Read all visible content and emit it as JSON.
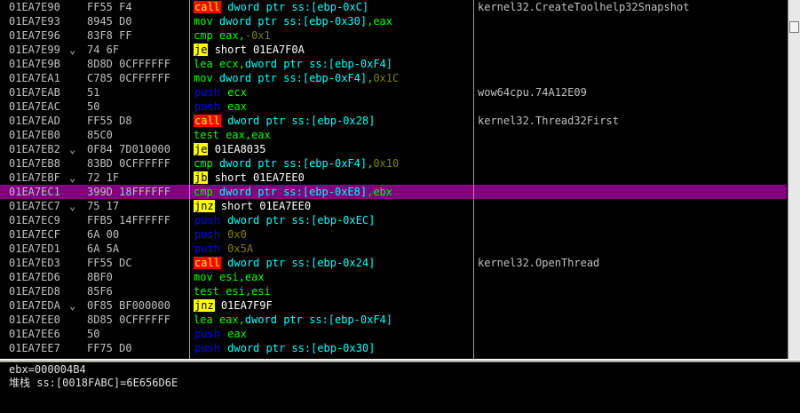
{
  "disasm": {
    "rows": [
      {
        "addr": "01EA7E90",
        "jmp": "",
        "hex": "FF55 F4",
        "mn": "call",
        "mk": "call",
        "ops": [
          {
            "t": "dword ptr ss:[ebp-0xC]",
            "c": "#00ffff"
          }
        ],
        "cmt": "kernel32.CreateToolhelp32Snapshot"
      },
      {
        "addr": "01EA7E93",
        "jmp": "",
        "hex": "8945 D0",
        "mn": "mov",
        "mk": "plain",
        "ops": [
          {
            "t": "dword ptr ss:[ebp-0x30]",
            "c": "#00ffff"
          },
          {
            "t": ",",
            "c": "#00ff00"
          },
          {
            "t": "eax",
            "c": "#00ff00"
          }
        ],
        "cmt": ""
      },
      {
        "addr": "01EA7E96",
        "jmp": "",
        "hex": "83F8 FF",
        "mn": "cmp",
        "mk": "plain",
        "ops": [
          {
            "t": "eax",
            "c": "#00ff00"
          },
          {
            "t": ",",
            "c": "#00ff00"
          },
          {
            "t": "-0x1",
            "c": "#808000"
          }
        ],
        "cmt": ""
      },
      {
        "addr": "01EA7E99",
        "jmp": "⌄",
        "hex": "74 6F",
        "mn": "je",
        "mk": "jmp",
        "ops": [
          {
            "t": "short 01EA7F0A",
            "c": "#ffffff"
          }
        ],
        "cmt": ""
      },
      {
        "addr": "01EA7E9B",
        "jmp": "",
        "hex": "8D8D 0CFFFFFF",
        "mn": "lea",
        "mk": "plain",
        "ops": [
          {
            "t": "ecx",
            "c": "#00ff00"
          },
          {
            "t": ",",
            "c": "#00ff00"
          },
          {
            "t": "dword ptr ss:[ebp-0xF4]",
            "c": "#00ffff"
          }
        ],
        "cmt": ""
      },
      {
        "addr": "01EA7EA1",
        "jmp": "",
        "hex": "C785 0CFFFFFF",
        "mn": "mov",
        "mk": "plain",
        "ops": [
          {
            "t": "dword ptr ss:[ebp-0xF4]",
            "c": "#00ffff"
          },
          {
            "t": ",",
            "c": "#00ff00"
          },
          {
            "t": "0x1C",
            "c": "#808000"
          }
        ],
        "cmt": ""
      },
      {
        "addr": "01EA7EAB",
        "jmp": "",
        "hex": "51",
        "mn": "push",
        "mk": "push",
        "ops": [
          {
            "t": "ecx",
            "c": "#00ff00"
          }
        ],
        "cmt": "wow64cpu.74A12E09"
      },
      {
        "addr": "01EA7EAC",
        "jmp": "",
        "hex": "50",
        "mn": "push",
        "mk": "push",
        "ops": [
          {
            "t": "eax",
            "c": "#00ff00"
          }
        ],
        "cmt": ""
      },
      {
        "addr": "01EA7EAD",
        "jmp": "",
        "hex": "FF55 D8",
        "mn": "call",
        "mk": "call",
        "ops": [
          {
            "t": "dword ptr ss:[ebp-0x28]",
            "c": "#00ffff"
          }
        ],
        "cmt": "kernel32.Thread32First"
      },
      {
        "addr": "01EA7EB0",
        "jmp": "",
        "hex": "85C0",
        "mn": "test",
        "mk": "plain",
        "ops": [
          {
            "t": "eax",
            "c": "#00ff00"
          },
          {
            "t": ",",
            "c": "#00ff00"
          },
          {
            "t": "eax",
            "c": "#00ff00"
          }
        ],
        "cmt": ""
      },
      {
        "addr": "01EA7EB2",
        "jmp": "⌄",
        "hex": "0F84 7D010000",
        "mn": "je",
        "mk": "jmp",
        "ops": [
          {
            "t": "01EA8035",
            "c": "#ffffff"
          }
        ],
        "cmt": ""
      },
      {
        "addr": "01EA7EB8",
        "jmp": "",
        "hex": "83BD 0CFFFFFF",
        "mn": "cmp",
        "mk": "plain",
        "ops": [
          {
            "t": "dword ptr ss:[ebp-0xF4]",
            "c": "#00ffff"
          },
          {
            "t": ",",
            "c": "#00ff00"
          },
          {
            "t": "0x10",
            "c": "#808000"
          }
        ],
        "cmt": ""
      },
      {
        "addr": "01EA7EBF",
        "jmp": "⌄",
        "hex": "72 1F",
        "mn": "jb",
        "mk": "jmp",
        "ops": [
          {
            "t": "short 01EA7EE0",
            "c": "#ffffff"
          }
        ],
        "cmt": ""
      },
      {
        "addr": "01EA7EC1",
        "jmp": "",
        "hex": "399D 18FFFFFF",
        "mn": "cmp",
        "mk": "plain",
        "ops": [
          {
            "t": "dword ptr ss:[ebp-0xE8]",
            "c": "#00ffff"
          },
          {
            "t": ",",
            "c": "#00ff00"
          },
          {
            "t": "ebx",
            "c": "#00ff00"
          }
        ],
        "cmt": "",
        "sel": true
      },
      {
        "addr": "01EA7EC7",
        "jmp": "⌄",
        "hex": "75 17",
        "mn": "jnz",
        "mk": "jmp",
        "ops": [
          {
            "t": "short 01EA7EE0",
            "c": "#ffffff"
          }
        ],
        "cmt": ""
      },
      {
        "addr": "01EA7EC9",
        "jmp": "",
        "hex": "FFB5 14FFFFFF",
        "mn": "push",
        "mk": "push",
        "ops": [
          {
            "t": "dword ptr ss:[ebp-0xEC]",
            "c": "#00ffff"
          }
        ],
        "cmt": ""
      },
      {
        "addr": "01EA7ECF",
        "jmp": "",
        "hex": "6A 00",
        "mn": "push",
        "mk": "push",
        "ops": [
          {
            "t": "0x0",
            "c": "#808000"
          }
        ],
        "cmt": ""
      },
      {
        "addr": "01EA7ED1",
        "jmp": "",
        "hex": "6A 5A",
        "mn": "push",
        "mk": "push",
        "ops": [
          {
            "t": "0x5A",
            "c": "#808000"
          }
        ],
        "cmt": ""
      },
      {
        "addr": "01EA7ED3",
        "jmp": "",
        "hex": "FF55 DC",
        "mn": "call",
        "mk": "call",
        "ops": [
          {
            "t": "dword ptr ss:[ebp-0x24]",
            "c": "#00ffff"
          }
        ],
        "cmt": "kernel32.OpenThread"
      },
      {
        "addr": "01EA7ED6",
        "jmp": "",
        "hex": "8BF0",
        "mn": "mov",
        "mk": "plain",
        "ops": [
          {
            "t": "esi",
            "c": "#00ff00"
          },
          {
            "t": ",",
            "c": "#00ff00"
          },
          {
            "t": "eax",
            "c": "#00ff00"
          }
        ],
        "cmt": ""
      },
      {
        "addr": "01EA7ED8",
        "jmp": "",
        "hex": "85F6",
        "mn": "test",
        "mk": "plain",
        "ops": [
          {
            "t": "esi",
            "c": "#00ff00"
          },
          {
            "t": ",",
            "c": "#00ff00"
          },
          {
            "t": "esi",
            "c": "#00ff00"
          }
        ],
        "cmt": ""
      },
      {
        "addr": "01EA7EDA",
        "jmp": "⌄",
        "hex": "0F85 BF000000",
        "mn": "jnz",
        "mk": "jmp",
        "ops": [
          {
            "t": "01EA7F9F",
            "c": "#ffffff"
          }
        ],
        "cmt": ""
      },
      {
        "addr": "01EA7EE0",
        "jmp": "",
        "hex": "8D85 0CFFFFFF",
        "mn": "lea",
        "mk": "plain",
        "ops": [
          {
            "t": "eax",
            "c": "#00ff00"
          },
          {
            "t": ",",
            "c": "#00ff00"
          },
          {
            "t": "dword ptr ss:[ebp-0xF4]",
            "c": "#00ffff"
          }
        ],
        "cmt": ""
      },
      {
        "addr": "01EA7EE6",
        "jmp": "",
        "hex": "50",
        "mn": "push",
        "mk": "push",
        "ops": [
          {
            "t": "eax",
            "c": "#00ff00"
          }
        ],
        "cmt": ""
      },
      {
        "addr": "01EA7EE7",
        "jmp": "",
        "hex": "FF75 D0",
        "mn": "push",
        "mk": "push",
        "ops": [
          {
            "t": "dword ptr ss:[ebp-0x30]",
            "c": "#00ffff"
          }
        ],
        "cmt": ""
      }
    ]
  },
  "info": {
    "line1": "ebx=000004B4",
    "line2": "堆栈 ss:[0018FABC]=6E656D6E"
  },
  "colors": {
    "background": "#000000",
    "selected_row": "#800080",
    "call_bg": "#ff0000",
    "jump_bg": "#ffff00",
    "push": "#0000ff",
    "register": "#00ff00",
    "memory": "#00ffff",
    "immediate": "#808000"
  }
}
